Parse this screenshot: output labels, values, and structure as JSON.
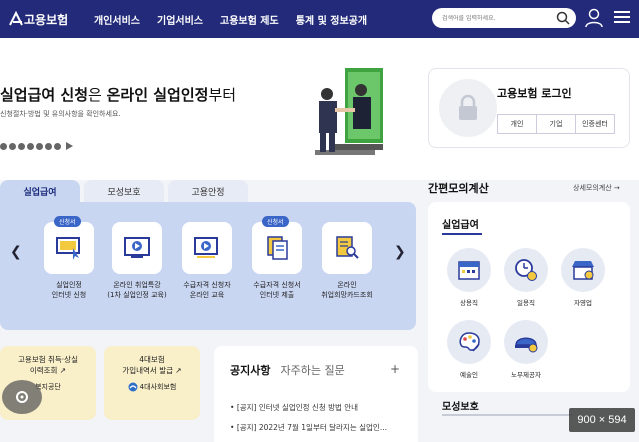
{
  "header": {
    "logo_text": "고용보험",
    "nav": [
      "개인서비스",
      "기업서비스",
      "고용보험 제도",
      "통계 및 정보공개"
    ],
    "search_placeholder": "검색어를 입력하세요."
  },
  "hero": {
    "title_part1": "실업급여 신청",
    "title_part2": "은 ",
    "title_part3": "온라인 실업인정",
    "title_part4": "부터",
    "subtitle": "신청절차·방법 및 유의사항을 확인하세요."
  },
  "login": {
    "title": "고용보험 로그인",
    "buttons": [
      "개인",
      "기업",
      "인증센터"
    ]
  },
  "service_tabs": [
    "실업급여",
    "모성보호",
    "고용안정"
  ],
  "services": [
    {
      "badge": "신청서",
      "line1": "실업인정",
      "line2": "인터넷 신청"
    },
    {
      "badge": "",
      "line1": "온라인 취업특강",
      "line2": "(1차 실업인정 교육)"
    },
    {
      "badge": "",
      "line1": "수급자격 신청자",
      "line2": "온라인 교육"
    },
    {
      "badge": "신청서",
      "line1": "수급자격 신청서",
      "line2": "인터넷 제출"
    },
    {
      "badge": "",
      "line1": "온라인",
      "line2": "취업희망카드조회"
    }
  ],
  "info_cards": [
    {
      "line1": "고용보험 취득·상실",
      "line2": "이력조회",
      "org": "복지공단"
    },
    {
      "line1": "4대보험",
      "line2": "가입내역서 발급",
      "org": "4대사회보험"
    }
  ],
  "notice": {
    "tabs": [
      "공지사항",
      "자주하는 질문"
    ],
    "plus": "+",
    "items": [
      "[공지] 인터넷 실업인정 신청 방법 안내",
      "[공지] 2022년 7월 1일부터 달라지는 실업인..."
    ]
  },
  "calculator": {
    "title": "간편모의계산",
    "more": "상세모의계산 →",
    "section": "실업급여",
    "items": [
      "상용직",
      "일용직",
      "자영업",
      "예술인",
      "노무제공자"
    ],
    "section2": "모성보호"
  },
  "overlay": {
    "size_badge": "900 × 594"
  },
  "colors": {
    "header_bg": "#232a7a",
    "panel_bg": "#c9d6f2",
    "accent": "#3a66c8"
  }
}
